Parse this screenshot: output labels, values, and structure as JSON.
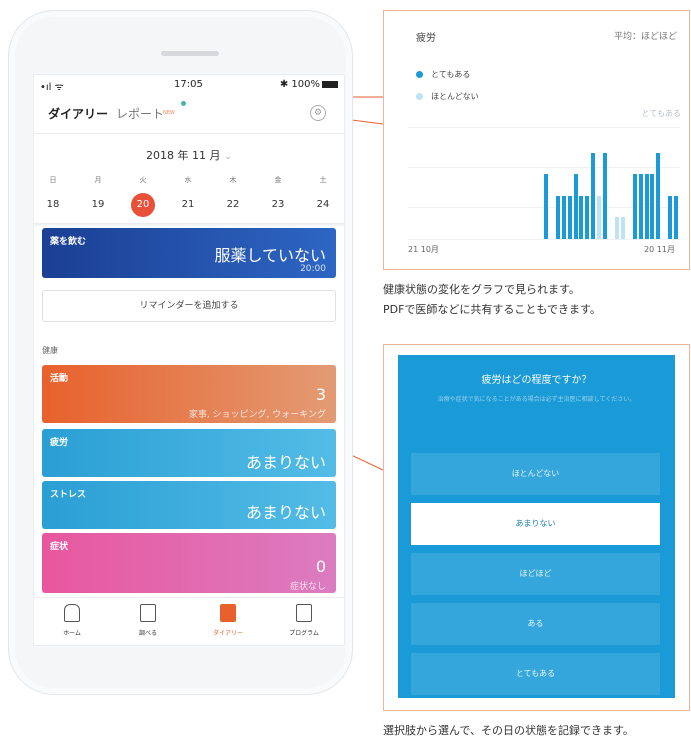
{
  "status_bar": {
    "signal": "•ıl ᯤ",
    "time": "17:05",
    "battery": "✱ 100%"
  },
  "app_tabs": {
    "diary": "ダイアリー",
    "report": "レポート",
    "new_tag": "NEW"
  },
  "calendar": {
    "month": "2018 年 11 月",
    "weekdays": [
      "日",
      "月",
      "火",
      "水",
      "木",
      "金",
      "土"
    ],
    "days": [
      "18",
      "19",
      "20",
      "21",
      "22",
      "23",
      "24"
    ],
    "selected_day": "20"
  },
  "medication": {
    "title": "薬を飲む",
    "value": "服薬していない",
    "time": "20:00"
  },
  "reminder_button": "リマインダーを追加する",
  "health_section_label": "健康",
  "activity": {
    "title": "活動",
    "value": "3",
    "detail": "家事, ショッピング, ウォーキング"
  },
  "fatigue": {
    "title": "疲労",
    "value": "あまりない"
  },
  "stress": {
    "title": "ストレス",
    "value": "あまりない"
  },
  "symptoms": {
    "title": "症状",
    "value": "0",
    "detail": "症状なし"
  },
  "bottom_nav": {
    "home": "ホーム",
    "search": "調べる",
    "diary": "ダイアリー",
    "program": "プログラム"
  },
  "report_panel": {
    "title": "疲労",
    "average": "平均：ほどほど",
    "legend_high": "とてもある",
    "legend_low": "ほとんどない",
    "axis_label": "とてもある",
    "x_start": "21 10月",
    "x_end": "20 11月"
  },
  "chart_data": {
    "type": "bar",
    "title": "疲労",
    "series": [
      {
        "name": "とてもある",
        "values": [
          0,
          0,
          0,
          0,
          0,
          0,
          0,
          0,
          0,
          0,
          0,
          0,
          0,
          0,
          0,
          0,
          0,
          0,
          0,
          0,
          0,
          0,
          0,
          3,
          0,
          2,
          2,
          2,
          3,
          2,
          2,
          4,
          0,
          4,
          0,
          0,
          0,
          0,
          3,
          3,
          3,
          3,
          4,
          0,
          2,
          2
        ]
      },
      {
        "name": "ほとんどない",
        "values": [
          0,
          0,
          0,
          0,
          0,
          0,
          0,
          0,
          0,
          0,
          0,
          0,
          0,
          0,
          0,
          0,
          0,
          0,
          0,
          0,
          0,
          0,
          0,
          0,
          0,
          0,
          0,
          0,
          0,
          0,
          0,
          0,
          2,
          0,
          0,
          1,
          1,
          0,
          0,
          0,
          0,
          0,
          0,
          0,
          0,
          0
        ]
      }
    ],
    "ylim": [
      0,
      5
    ]
  },
  "caption_1_line1": "健康状態の変化をグラフで見られます。",
  "caption_1_line2": "PDFで医師などに共有することもできます。",
  "question_panel": {
    "question": "疲労はどの程度ですか？",
    "note": "治療や症状で気になることがある場合は必ず主治医に相談してください。",
    "options": [
      "ほとんどない",
      "あまりない",
      "ほどほど",
      "ある",
      "とてもある"
    ],
    "selected": "あまりない"
  },
  "caption_2": "選択肢から選んで、その日の状態を記録できます。",
  "colors": {
    "accent_orange": "#e8612c",
    "accent_blue": "#1a9ad6",
    "navy": "#1b3f93",
    "pink": "#e8579e",
    "selected_red": "#e8503a"
  }
}
